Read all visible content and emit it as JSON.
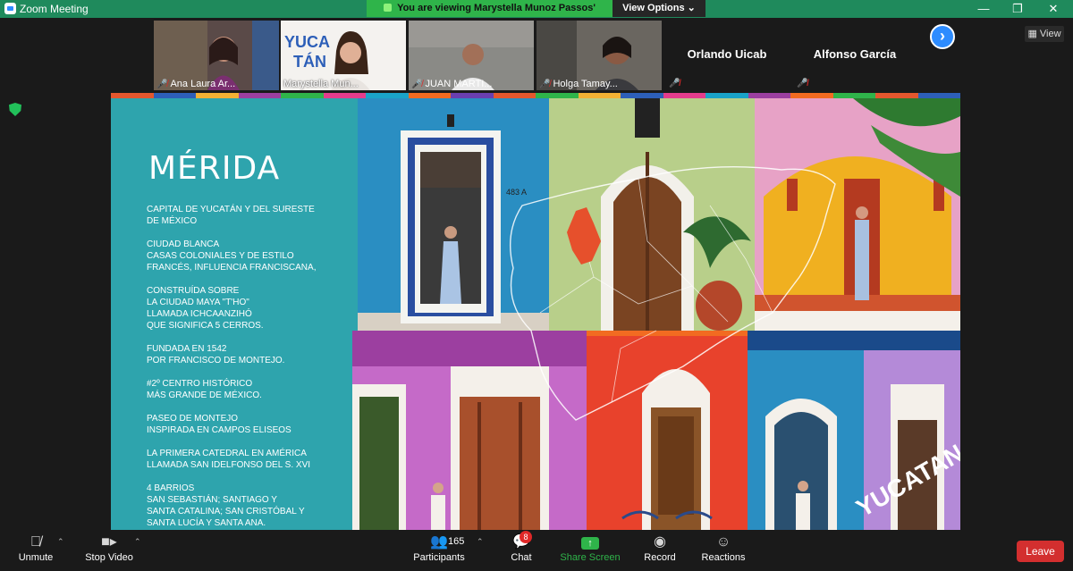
{
  "window": {
    "title": "Zoom Meeting"
  },
  "share_banner": {
    "text": "You are viewing Marystella Munoz Passos' screen",
    "view_options": "View Options"
  },
  "participants": [
    {
      "name": "Ana Laura Ar..."
    },
    {
      "name": "Marystella Mun..."
    },
    {
      "name": "JUAN MARTI..."
    },
    {
      "name": "Holga Tamay..."
    },
    {
      "name": "Orlando Uicab"
    },
    {
      "name": "Alfonso García"
    }
  ],
  "view_button": "View",
  "slide": {
    "title": "MÉRIDA",
    "facts": [
      "Capital de Yucatán y del Sureste\nde México",
      "Ciudad Blanca\nCasas coloniales y de estilo\nFrancés, influencia franciscana,",
      "Construída sobre\nla ciudad Maya \"T'HO\"\nllamada Ichcaanzihó\nque significa 5 cerros.",
      "Fundada en 1542\npor Francisco de Montejo.",
      "#2º Centro histórico\nmás grande de México.",
      "Paseo de Montejo\ninspirada en Campos Eliseos",
      "La primera catedral en América\nllamada San Idelfonso del s. XVI",
      "4 Barrios\nSan Sebastián; Santiago y\nSanta Catalina; San Cristóbal y\nSanta Lucía y Santa Ana."
    ],
    "house_number": "483 A",
    "logo_text": "YUCATAN"
  },
  "toolbar": {
    "unmute": "Unmute",
    "stop_video": "Stop Video",
    "participants": "Participants",
    "participants_count": "165",
    "chat": "Chat",
    "chat_badge": "8",
    "share_screen": "Share Screen",
    "record": "Record",
    "reactions": "Reactions",
    "leave": "Leave"
  },
  "colors": {
    "zoom_green": "#2fb44a",
    "zoom_blue": "#2d8cff",
    "leave_red": "#d32f2f",
    "slide_teal": "#2ea4ad"
  }
}
